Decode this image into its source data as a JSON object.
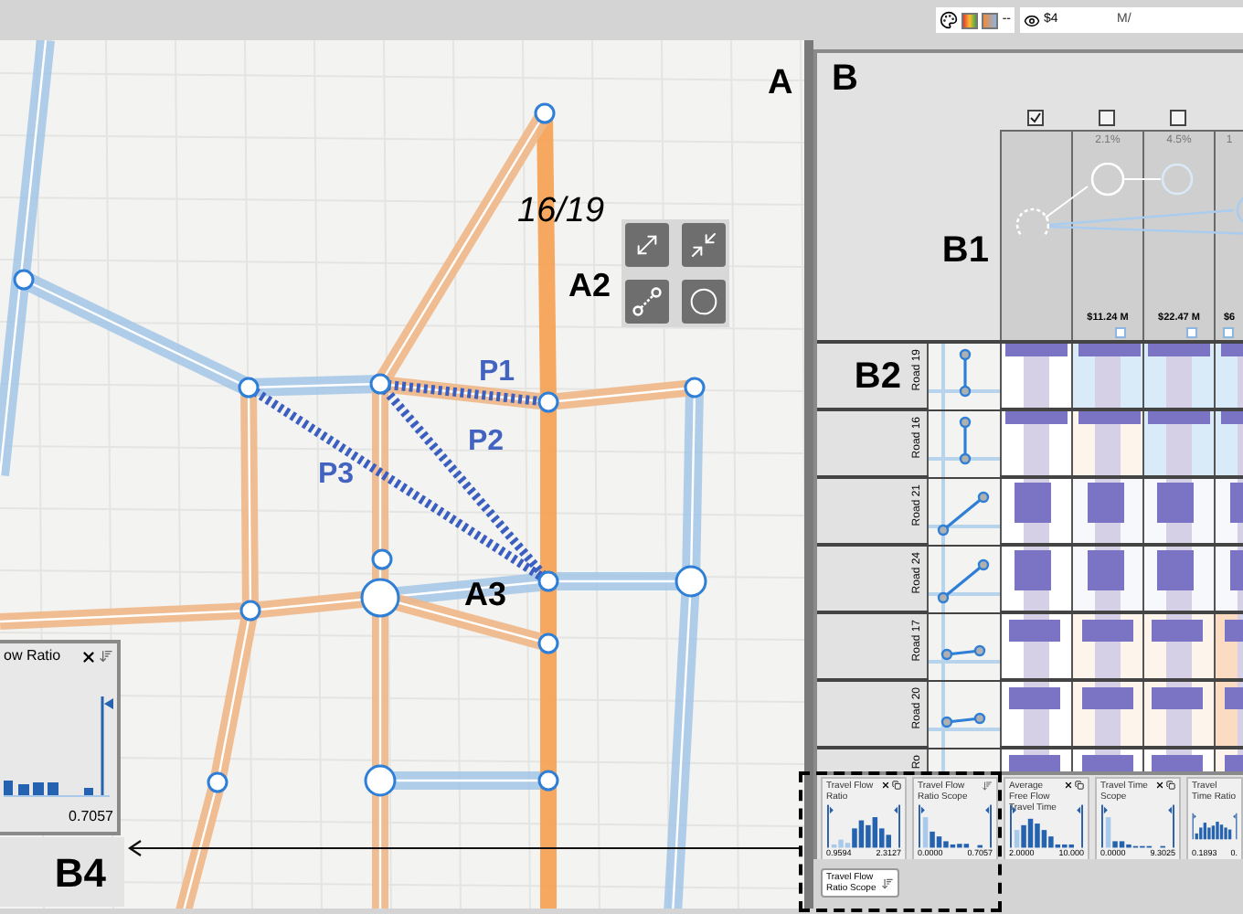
{
  "toolbar": {
    "trailing_mark": "--",
    "cost": "$4",
    "cut_label": "M/"
  },
  "map": {
    "label": "A",
    "count": "16/19",
    "tools_label": "A2",
    "tools": [
      {
        "kind": "stretch"
      },
      {
        "kind": "shrink"
      },
      {
        "kind": "link"
      },
      {
        "kind": "ring"
      }
    ],
    "path_labels": [
      "P1",
      "P2",
      "P3"
    ],
    "focus_label": "A3"
  },
  "popup": {
    "title": "ow Ratio",
    "max": "0.7057"
  },
  "callout_label": "B4",
  "panel_b": {
    "label": "B",
    "header_label": "B1",
    "rows_label": "B2",
    "columns": [
      {
        "checked": true
      },
      {
        "checked": false,
        "share": "2.1%",
        "cost": "$11.24 M"
      },
      {
        "checked": false,
        "share": "4.5%",
        "cost": "$22.47 M"
      },
      {
        "share": "1",
        "cost": "$6"
      }
    ],
    "rows": [
      {
        "name": "Road 19",
        "kind": "top-strip",
        "cells": [
          {
            "color": "#ffffff"
          },
          {
            "color": "#d9eaf8"
          },
          {
            "color": "#d9eaf8"
          },
          {
            "color": "#d9eaf8"
          }
        ]
      },
      {
        "name": "Road 16",
        "kind": "top-strip",
        "cells": [
          {
            "color": "#ffffff"
          },
          {
            "color": "#fdf4ec"
          },
          {
            "color": "#d9eaf8"
          },
          {
            "color": "#d9eaf8"
          }
        ]
      },
      {
        "name": "Road 21",
        "kind": "tall-bar",
        "cells": [
          {
            "color": "#ffffff"
          },
          {
            "color": "#f6f8fc"
          },
          {
            "color": "#f6f8fc"
          },
          {
            "color": "#f6f8fc"
          }
        ]
      },
      {
        "name": "Road 24",
        "kind": "tall-bar",
        "cells": [
          {
            "color": "#ffffff"
          },
          {
            "color": "#f6f8fc"
          },
          {
            "color": "#f6f8fc"
          },
          {
            "color": "#f6f8fc"
          }
        ]
      },
      {
        "name": "Road 17",
        "kind": "short-bar",
        "cells": [
          {
            "color": "#ffffff"
          },
          {
            "color": "#fdf4ec"
          },
          {
            "color": "#fdf4ec"
          },
          {
            "color": "#fbdcc2"
          }
        ]
      },
      {
        "name": "Road 20",
        "kind": "short-bar",
        "cells": [
          {
            "color": "#ffffff"
          },
          {
            "color": "#fdf4ec"
          },
          {
            "color": "#fdf4ec"
          },
          {
            "color": "#fbdcc2"
          }
        ]
      },
      {
        "name": "Ro",
        "kind": "short-bar",
        "cells": [
          {
            "color": "#ffffff"
          },
          {
            "color": "#ffffff"
          },
          {
            "color": "#ffffff"
          },
          {
            "color": "#fdf4ec"
          }
        ]
      }
    ]
  },
  "filters": [
    {
      "title": "Travel Flow Ratio",
      "kind": "removable",
      "min": "0.9594",
      "max": "2.3127"
    },
    {
      "title": "Travel Flow Ratio Scope",
      "kind": "sorted",
      "min": "0.0000",
      "max": "0.7057"
    },
    {
      "title": "Average Free Flow Travel Time",
      "kind": "removable",
      "min": "2.0000",
      "max": "10.000"
    },
    {
      "title": "Travel Time Scope",
      "kind": "removable",
      "min": "0.0000",
      "max": "9.3025"
    },
    {
      "title": "Travel Time Ratio",
      "kind": "cut",
      "min": "0.1893",
      "max": "0."
    }
  ],
  "chip": {
    "label": "Travel Flow Ratio Scope"
  }
}
